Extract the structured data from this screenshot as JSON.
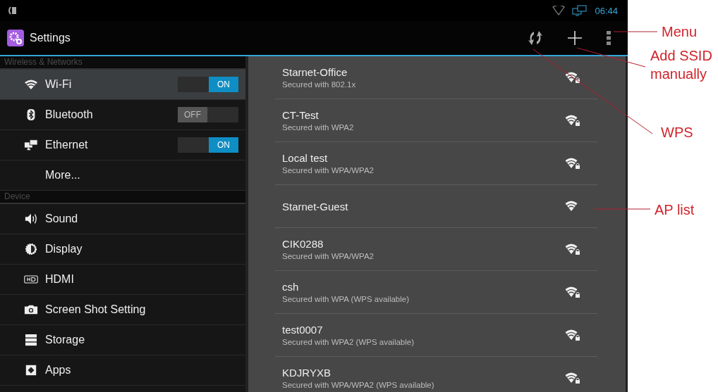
{
  "status_bar": {
    "time": "06:44"
  },
  "action_bar": {
    "title": "Settings"
  },
  "sidebar": {
    "sections": [
      {
        "header": "Wireless & Networks",
        "items": [
          {
            "label": "Wi-Fi",
            "kind": "toggle",
            "on": true,
            "switch_text": "ON",
            "selected": true
          },
          {
            "label": "Bluetooth",
            "kind": "toggle",
            "on": false,
            "switch_text": "OFF",
            "selected": false
          },
          {
            "label": "Ethernet",
            "kind": "toggle",
            "on": true,
            "switch_text": "ON",
            "selected": false
          },
          {
            "label": "More...",
            "kind": "plain",
            "selected": false
          }
        ]
      },
      {
        "header": "Device",
        "items": [
          {
            "label": "Sound",
            "kind": "plain",
            "selected": false
          },
          {
            "label": "Display",
            "kind": "plain",
            "selected": false
          },
          {
            "label": "HDMI",
            "kind": "plain",
            "selected": false
          },
          {
            "label": "Screen Shot Setting",
            "kind": "plain",
            "selected": false
          },
          {
            "label": "Storage",
            "kind": "plain",
            "selected": false
          },
          {
            "label": "Apps",
            "kind": "plain",
            "selected": false
          }
        ]
      }
    ]
  },
  "access_points": [
    {
      "name": "Starnet-Office",
      "security": "Secured with 802.1x",
      "locked": true
    },
    {
      "name": "CT-Test",
      "security": "Secured with WPA2",
      "locked": true
    },
    {
      "name": "Local test",
      "security": "Secured with WPA/WPA2",
      "locked": true
    },
    {
      "name": "Starnet-Guest",
      "locked": false
    },
    {
      "name": "CIK0288",
      "security": "Secured with WPA/WPA2",
      "locked": true
    },
    {
      "name": "csh",
      "security": "Secured with WPA (WPS available)",
      "locked": true
    },
    {
      "name": "test0007",
      "security": "Secured with WPA2 (WPS available)",
      "locked": true
    },
    {
      "name": "KDJRYXB",
      "security": "Secured with WPA/WPA2 (WPS available)",
      "locked": true
    }
  ],
  "annotations": [
    {
      "label": "Menu"
    },
    {
      "label": "Add SSID manually"
    },
    {
      "label": "WPS"
    },
    {
      "label": "AP list"
    }
  ]
}
